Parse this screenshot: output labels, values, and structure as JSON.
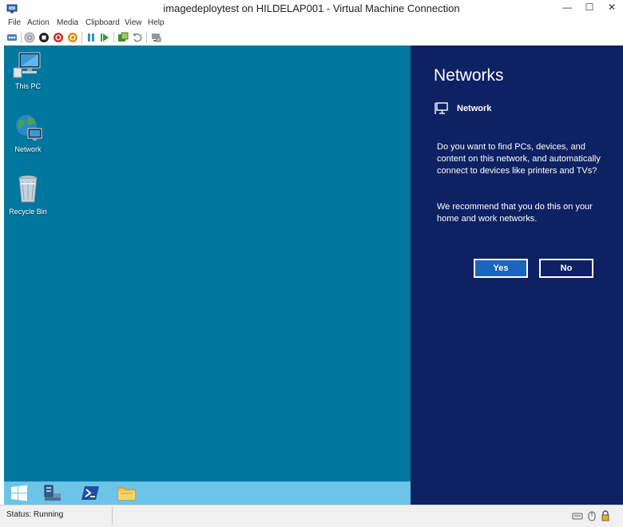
{
  "window": {
    "title": "imagedeploytest on HILDELAP001 - Virtual Machine Connection",
    "minimize_glyph": "—",
    "maximize_glyph": "☐",
    "close_glyph": "✕"
  },
  "menu": [
    "File",
    "Action",
    "Media",
    "Clipboard",
    "View",
    "Help"
  ],
  "toolbar": {
    "icons": [
      "ctrl-alt-del-icon",
      "start-icon",
      "turn-off-icon",
      "shut-down-icon",
      "save-icon",
      "pause-icon",
      "reset-icon",
      "checkpoint-icon",
      "revert-icon",
      "enhanced-session-icon"
    ]
  },
  "desktop": {
    "background_color": "#00779e",
    "icons": [
      {
        "label": "This PC",
        "icon": "computer-icon"
      },
      {
        "label": "Network",
        "icon": "network-globe-icon"
      },
      {
        "label": "Recycle Bin",
        "icon": "recycle-bin-icon"
      }
    ]
  },
  "taskbar": {
    "items": [
      "windows-start-icon",
      "server-manager-icon",
      "powershell-icon",
      "file-explorer-icon"
    ]
  },
  "charm": {
    "title": "Networks",
    "network_name": "Network",
    "question": "Do you want to find PCs, devices, and content on this network, and automatically connect to devices like printers and TVs?",
    "recommendation": "We recommend that you do this on your home and work networks.",
    "yes_label": "Yes",
    "no_label": "No",
    "background_color": "#0e2163"
  },
  "status": {
    "text": "Status: Running"
  }
}
